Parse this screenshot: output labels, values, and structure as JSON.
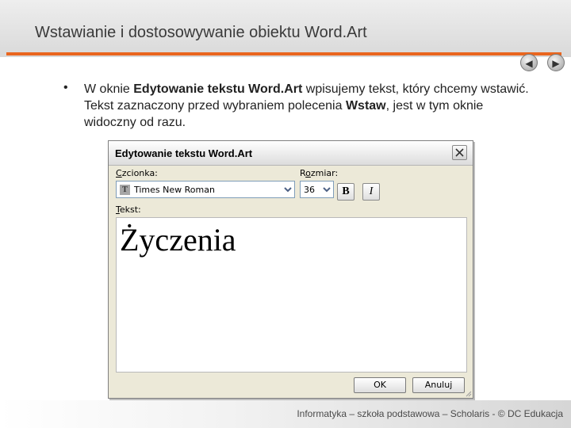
{
  "slide": {
    "title": "Wstawianie i dostosowywanie obiektu Word.Art",
    "bullet": "•",
    "paragraph": {
      "t1": "W oknie ",
      "b1": "Edytowanie tekstu Word.Art",
      "t2": " wpisujemy tekst, który chcemy wstawić. Tekst zaznaczony przed wybraniem polecenia ",
      "b2": "Wstaw",
      "t3": ", jest w tym oknie widoczny od razu."
    },
    "footer": "Informatyka – szkoła podstawowa – Scholaris - © DC Edukacja",
    "nav": {
      "prev_icon": "arrow-left-icon",
      "next_icon": "arrow-right-icon"
    },
    "accent_color": "#e9661f"
  },
  "dialog": {
    "title": "Edytowanie tekstu Word.Art",
    "font_label_hotkey": "C",
    "font_label_rest": "zcionka:",
    "font_value": "Times New Roman",
    "font_icon_glyph": "T",
    "size_label_pre": "R",
    "size_label_hotkey": "o",
    "size_label_rest": "zmiar:",
    "size_value": "36",
    "bold_label": "B",
    "italic_label": "I",
    "text_label_hotkey": "T",
    "text_label_rest": "ekst:",
    "text_value": "Życzenia",
    "ok_label": "OK",
    "cancel_label": "Anuluj",
    "icons": {
      "close": "close-icon",
      "dropdown": "chevron-down-icon",
      "font": "truetype-font-icon"
    }
  }
}
